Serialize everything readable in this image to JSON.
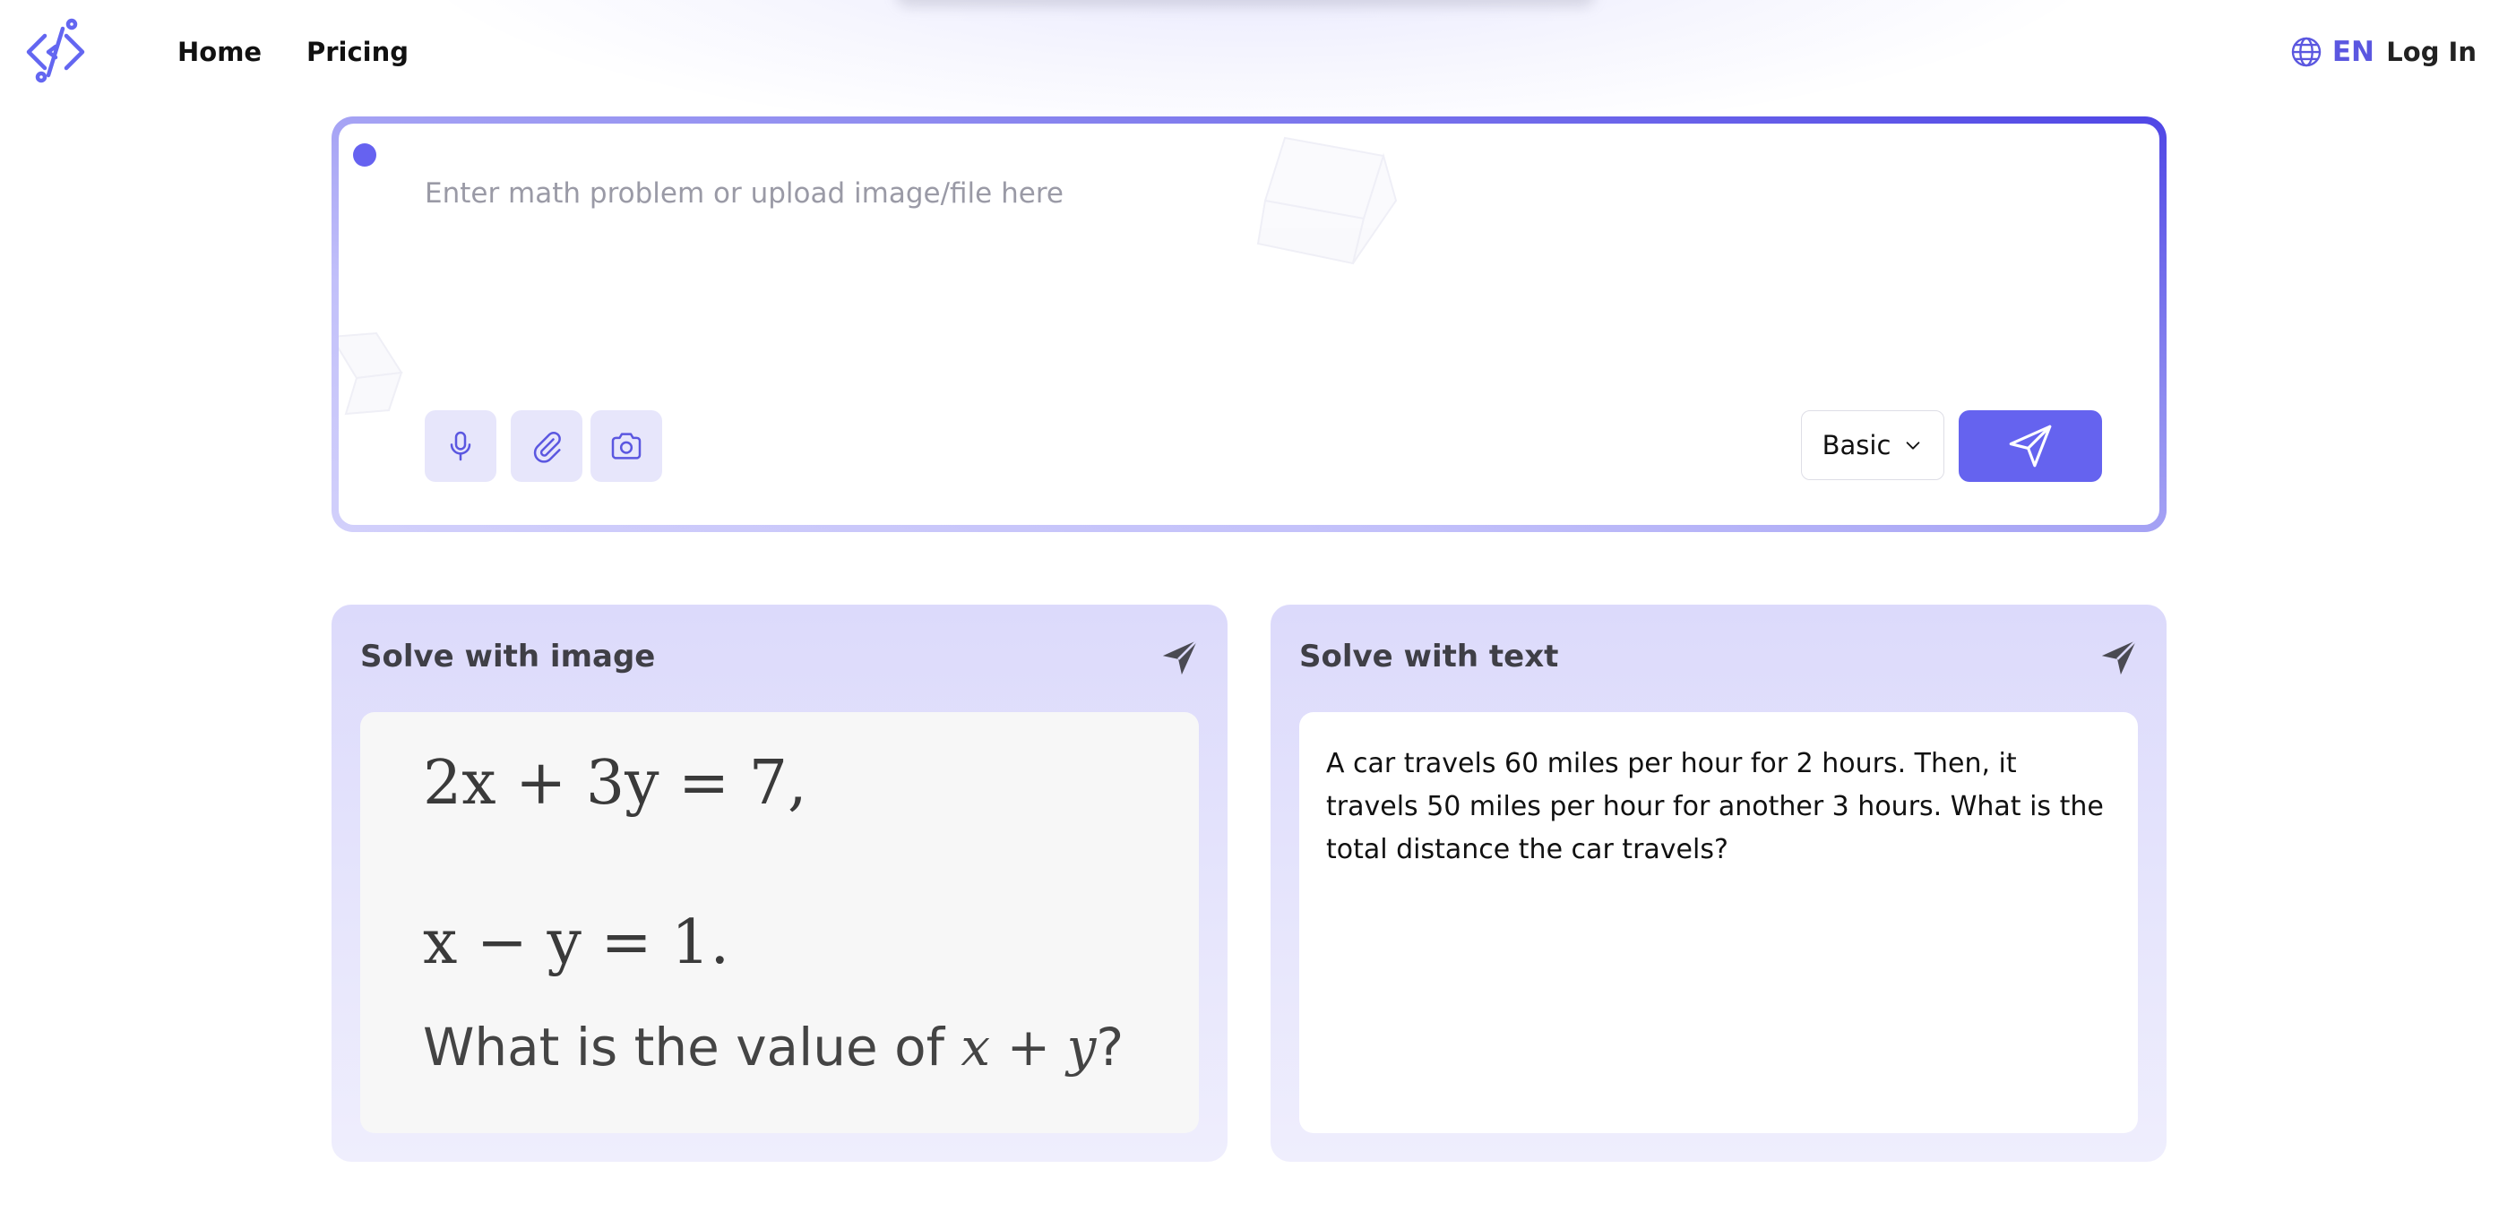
{
  "brand": {
    "logo_icon": "code-bracket-logo-icon",
    "accent_color": "#6563ef"
  },
  "nav": {
    "home": "Home",
    "pricing": "Pricing",
    "language": "EN",
    "language_icon": "globe-icon",
    "login": "Log In"
  },
  "input": {
    "placeholder": "Enter math problem or upload image/file here",
    "tools": [
      "microphone-icon",
      "paperclip-icon",
      "camera-icon"
    ],
    "mode": "Basic",
    "mode_icon": "chevron-down-icon",
    "send_icon": "paper-plane-icon"
  },
  "examples": {
    "image_card": {
      "title": "Solve with image",
      "equation_1": "2x + 3y = 7,",
      "equation_2": "x − y = 1.",
      "question_text": "What is the value of ",
      "question_math": "x + y",
      "question_end": "?"
    },
    "text_card": {
      "title": "Solve with text",
      "problem": "A car travels 60 miles per hour for 2 hours. Then, it travels 50 miles per hour for another 3 hours. What is the total distance the car travels?"
    }
  }
}
